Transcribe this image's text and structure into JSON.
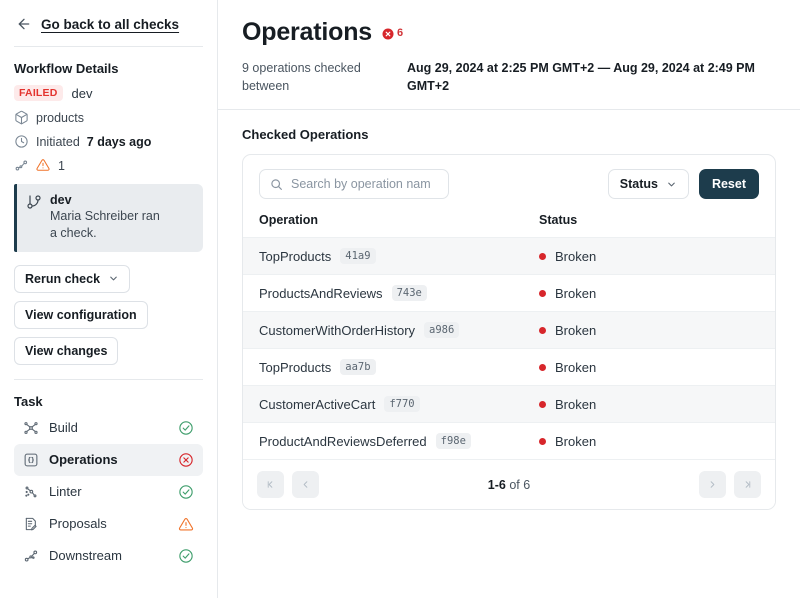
{
  "sidebar": {
    "back_link": "Go back to all checks",
    "workflow_details_title": "Workflow Details",
    "status_badge": "FAILED",
    "branch": "dev",
    "graph_name": "products",
    "initiated_prefix": "Initiated",
    "initiated_value": "7 days ago",
    "downstream_count": "1",
    "info_card": {
      "title": "dev",
      "subtitle": "Maria Schreiber ran a check."
    },
    "buttons": {
      "rerun": "Rerun check",
      "view_configuration": "View configuration",
      "view_changes": "View changes"
    },
    "task_title": "Task",
    "tasks": [
      {
        "label": "Build",
        "icon": "build-icon",
        "status": "success"
      },
      {
        "label": "Operations",
        "icon": "operations-icon",
        "status": "error"
      },
      {
        "label": "Linter",
        "icon": "linter-icon",
        "status": "success"
      },
      {
        "label": "Proposals",
        "icon": "proposals-icon",
        "status": "warning"
      },
      {
        "label": "Downstream",
        "icon": "downstream-icon",
        "status": "success"
      }
    ]
  },
  "main": {
    "title": "Operations",
    "error_count": "6",
    "summary_left": "9 operations checked between",
    "summary_right": "Aug 29, 2024 at 2:25 PM GMT+2 — Aug 29, 2024 at 2:49 PM GMT+2",
    "panel_title": "Checked Operations",
    "search_placeholder": "Search by operation nam",
    "search_value": "",
    "status_filter_label": "Status",
    "reset_label": "Reset",
    "columns": {
      "operation": "Operation",
      "status": "Status"
    },
    "rows": [
      {
        "name": "TopProducts",
        "hash": "41a9",
        "status": "Broken"
      },
      {
        "name": "ProductsAndReviews",
        "hash": "743e",
        "status": "Broken"
      },
      {
        "name": "CustomerWithOrderHistory",
        "hash": "a986",
        "status": "Broken"
      },
      {
        "name": "TopProducts",
        "hash": "aa7b",
        "status": "Broken"
      },
      {
        "name": "CustomerActiveCart",
        "hash": "f770",
        "status": "Broken"
      },
      {
        "name": "ProductAndReviewsDeferred",
        "hash": "f98e",
        "status": "Broken"
      }
    ],
    "pagination": {
      "range": "1-6",
      "of_label": "of",
      "total": "6"
    }
  },
  "colors": {
    "danger": "#d7262b",
    "success": "#3f9e6c",
    "warning": "#f0732a",
    "accent_dark": "#1d3c4c",
    "failed_badge_bg": "#fdeaea",
    "failed_badge_fg": "#e3342f"
  }
}
